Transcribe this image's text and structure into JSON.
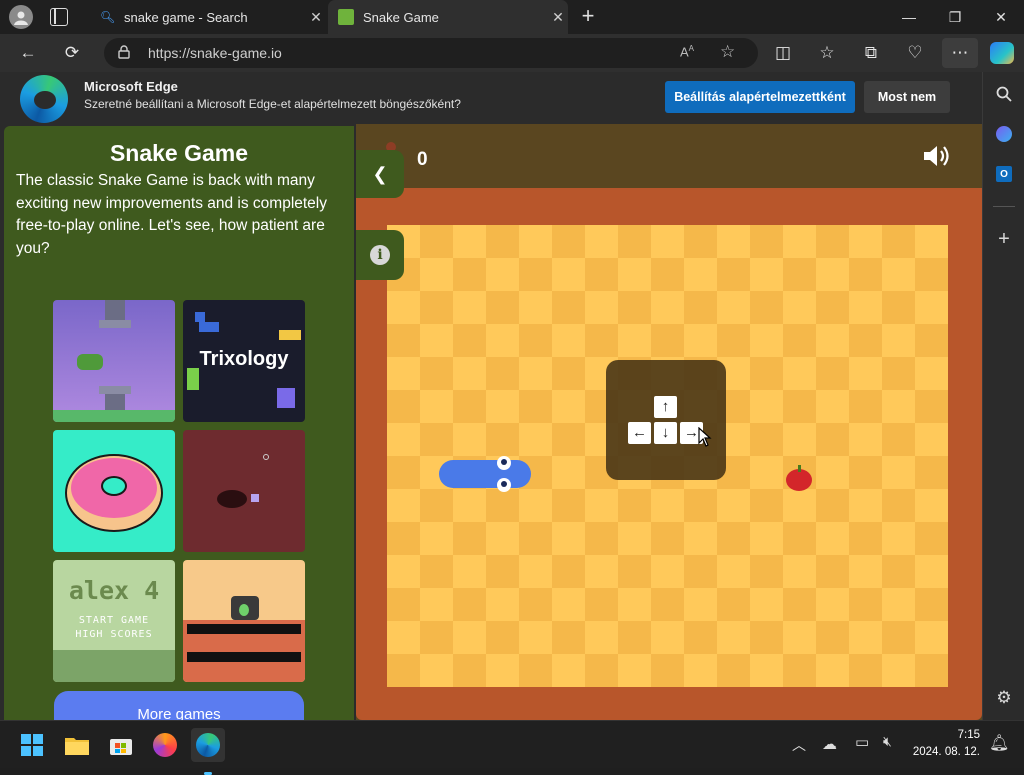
{
  "tabs": [
    {
      "title": "snake game - Search",
      "icon": "search-icon"
    },
    {
      "title": "Snake Game",
      "icon": "snake-game-favicon"
    }
  ],
  "address": {
    "url": "https://snake-game.io"
  },
  "infobar": {
    "app_name": "Microsoft Edge",
    "message": "Szeretné beállítani a Microsoft Edge-et alapértelmezett böngészőként?",
    "primary_button": "Beállítás alapértelmezettként",
    "secondary_button": "Most nem"
  },
  "panel": {
    "title": "Snake Game",
    "description": "The classic Snake Game is back with many exciting new improvements and is completely free-to-play online. Let's see, how patient are you?",
    "more_button": "More games",
    "games": [
      {
        "name": "flappy-tower-game"
      },
      {
        "name": "trixology-game",
        "label": "Trixology"
      },
      {
        "name": "donut-dots-game"
      },
      {
        "name": "dark-red-game"
      },
      {
        "name": "alex4-game",
        "line1": "alex 4",
        "line2": "START GAME",
        "line3": "HIGH SCORES"
      },
      {
        "name": "platform-robot-game"
      }
    ]
  },
  "game": {
    "score": "0",
    "arrows": {
      "up": "↑",
      "left": "←",
      "down": "↓",
      "right": "→"
    }
  },
  "taskbar": {
    "time": "7:15",
    "date": "2024. 08. 12."
  },
  "colors": {
    "accent": "#0f6cbd",
    "panel_green": "#3f5a1e",
    "board_light": "#ffc95a",
    "board_dark": "#f5b84a",
    "border_orange": "#b8562b",
    "snake_blue": "#4a7ae8",
    "more_games_blue": "#5b7cf0"
  }
}
